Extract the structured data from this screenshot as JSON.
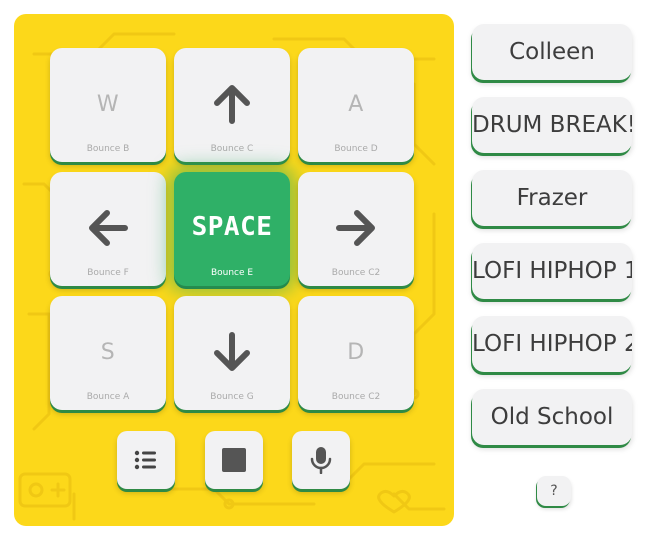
{
  "pads": [
    {
      "key": "W",
      "sound": "Bounce B",
      "icon": "letter"
    },
    {
      "key": "",
      "sound": "Bounce C",
      "icon": "arrow-up-icon"
    },
    {
      "key": "A",
      "sound": "Bounce D",
      "icon": "letter"
    },
    {
      "key": "",
      "sound": "Bounce F",
      "icon": "arrow-left-icon"
    },
    {
      "key": "SPACE",
      "sound": "Bounce E",
      "icon": "letter",
      "active": true
    },
    {
      "key": "",
      "sound": "Bounce C2",
      "icon": "arrow-right-icon"
    },
    {
      "key": "S",
      "sound": "Bounce A",
      "icon": "letter"
    },
    {
      "key": "",
      "sound": "Bounce G",
      "icon": "arrow-down-icon"
    },
    {
      "key": "D",
      "sound": "Bounce C2",
      "icon": "letter"
    }
  ],
  "controls": [
    {
      "icon": "list-icon"
    },
    {
      "icon": "stop-icon"
    },
    {
      "icon": "microphone-icon"
    }
  ],
  "beats": [
    "Colleen",
    "DRUM BREAK!",
    "Frazer",
    "LOFI HIPHOP 1",
    "LOFI HIPHOP 2",
    "Old School"
  ],
  "help_label": "?",
  "colors": {
    "board": "#fcd81a",
    "circuit": "#f0c814",
    "pad": "#f2f2f3",
    "active_pad": "#2fb067",
    "shadow_accent": "#2f8a45",
    "arrow": "#555555"
  }
}
